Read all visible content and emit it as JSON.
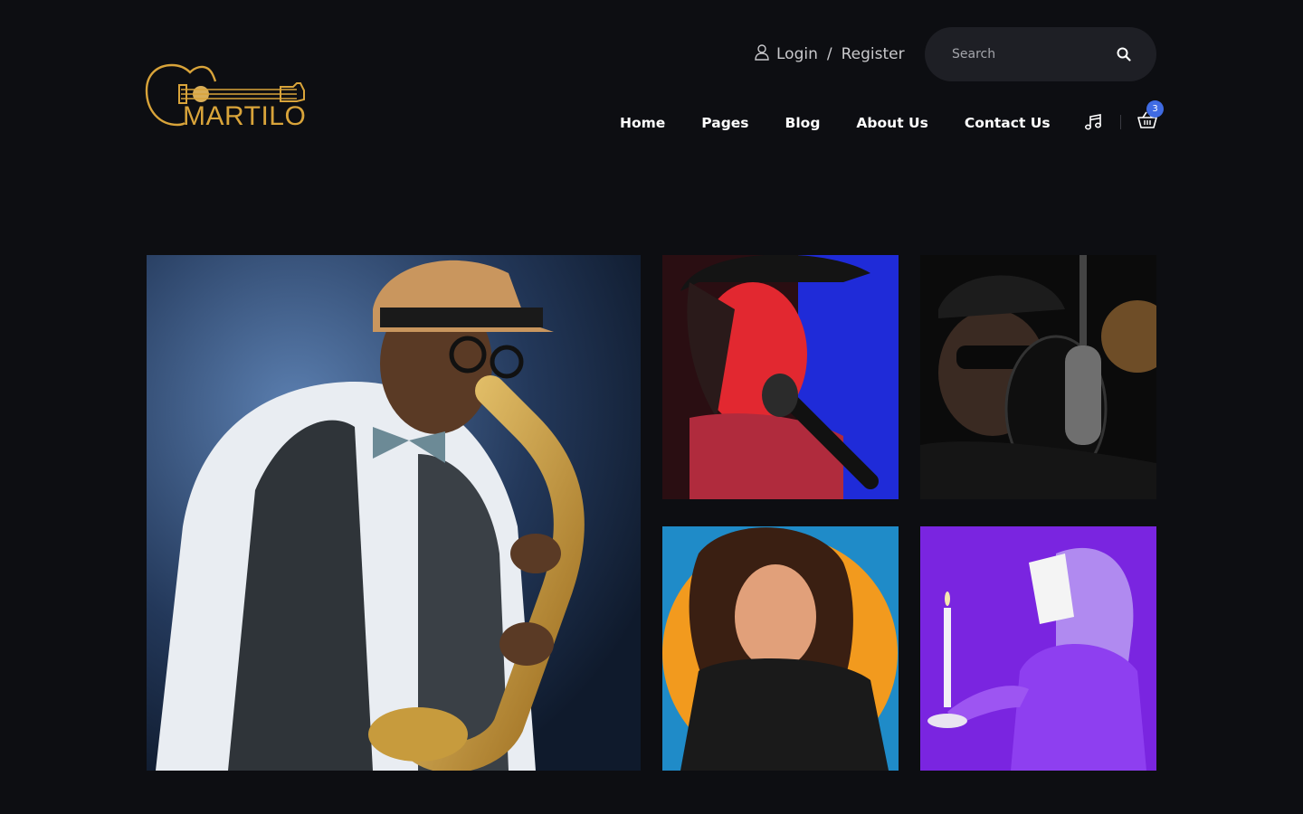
{
  "brand": {
    "name": "MARTILO",
    "accent": "#d9a43a"
  },
  "account": {
    "login_label": "Login",
    "separator": "/",
    "register_label": "Register"
  },
  "search": {
    "placeholder": "Search"
  },
  "nav": {
    "items": [
      {
        "label": "Home"
      },
      {
        "label": "Pages"
      },
      {
        "label": "Blog"
      },
      {
        "label": "About Us"
      },
      {
        "label": "Contact Us"
      }
    ]
  },
  "tools": {
    "music_icon": "music-note-icon",
    "cart_icon": "basket-icon",
    "cart_count": "3",
    "badge_color": "#3f6be3"
  },
  "gallery": {
    "images": [
      {
        "name": "gallery-image-saxophonist",
        "subject": "saxophonist"
      },
      {
        "name": "gallery-image-singer-red",
        "subject": "singer"
      },
      {
        "name": "gallery-image-studio-mic",
        "subject": "studio singer"
      },
      {
        "name": "gallery-image-woman-orange",
        "subject": "woman"
      },
      {
        "name": "gallery-image-purple-candle",
        "subject": "purple figure with candle"
      }
    ]
  },
  "colors": {
    "background": "#0d0e12",
    "search_bg": "#1e1f25"
  }
}
